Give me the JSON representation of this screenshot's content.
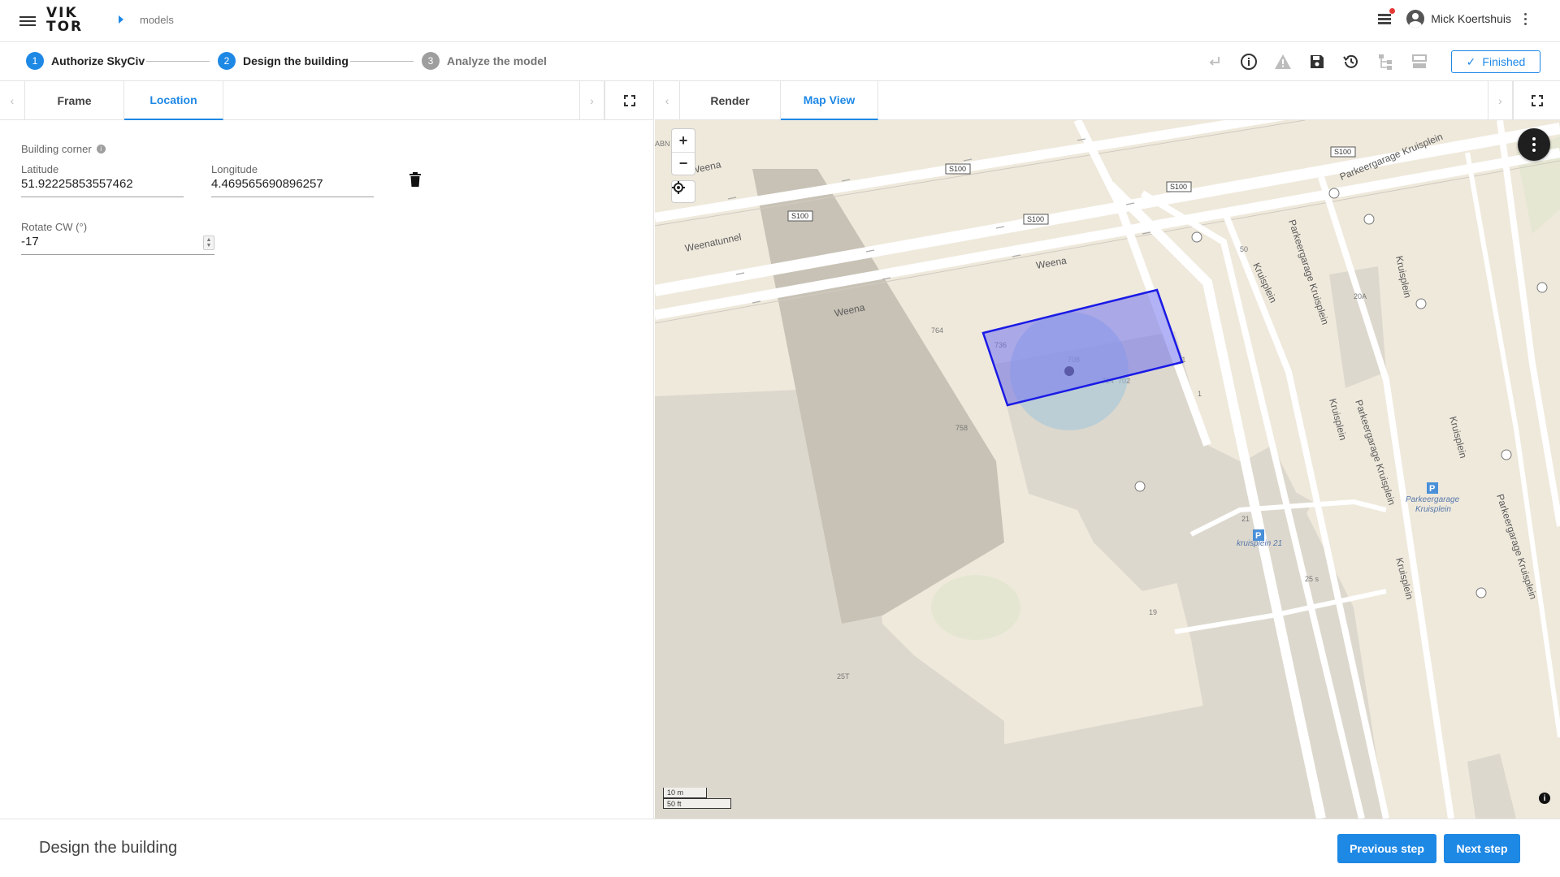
{
  "header": {
    "logo_top": "VIK",
    "logo_bottom": "TOR",
    "breadcrumb": "models",
    "user_name": "Mick Koertshuis"
  },
  "steps": [
    {
      "number": "1",
      "label": "Authorize SkyCiv"
    },
    {
      "number": "2",
      "label": "Design the building"
    },
    {
      "number": "3",
      "label": "Analyze the model"
    }
  ],
  "toolbar": {
    "icons": [
      "enter-icon",
      "info-icon",
      "warning-icon",
      "save-icon",
      "history-icon",
      "tree-icon",
      "layers-icon"
    ],
    "finished_label": "Finished"
  },
  "left_tabs": [
    "Frame",
    "Location"
  ],
  "form": {
    "section_label": "Building corner",
    "latitude_label": "Latitude",
    "latitude_value": "51.92225853557462",
    "longitude_label": "Longitude",
    "longitude_value": "4.469565690896257",
    "rotate_label": "Rotate CW (°)",
    "rotate_value": "-17"
  },
  "right_tabs": [
    "Render",
    "Map View"
  ],
  "map": {
    "labels": {
      "weena_1": "Weena",
      "weena_2": "Weena",
      "weena_3": "Weena",
      "weenatunnel": "Weenatunnel",
      "s100_1": "S100",
      "s100_2": "S100",
      "s100_3": "S100",
      "s100_4": "S100",
      "s100_5": "S100",
      "parkeergarage_1": "Parkeergarage Kruisplein",
      "parkeergarage_2": "Parkeergarage Kruisplein",
      "parkeergarage_3": "Parkeergarage Kruisplein",
      "parkeergarage_4": "Parkeergarage Kruisplein",
      "kruisplein_1": "Kruisplein",
      "kruisplein_2": "Kruisplein",
      "kruisplein_3": "Kruisplein",
      "kruisplein_4": "Kruisplein",
      "kruisplein_5": "Kruisplein",
      "parking_1_top": "Parkeergarage",
      "parking_1_bottom": "Kruisplein",
      "parking_2": "kruisplein 21",
      "n_764": "764",
      "n_736": "736",
      "n_708": "708",
      "n_724": "724",
      "n_702": "702",
      "n_758": "758",
      "n_11": "11",
      "n_1": "1",
      "n_20a": "20A",
      "n_21": "21",
      "n_25s": "25 s",
      "n_19": "19",
      "n_25t": "25T",
      "n_50": "50",
      "n_abn": "ABN"
    },
    "scale_m": "10 m",
    "scale_ft": "50 ft",
    "attribution": "i",
    "polygon_color": "#1a1ae6"
  },
  "footer": {
    "title": "Design the building",
    "previous_label": "Previous step",
    "next_label": "Next step"
  }
}
